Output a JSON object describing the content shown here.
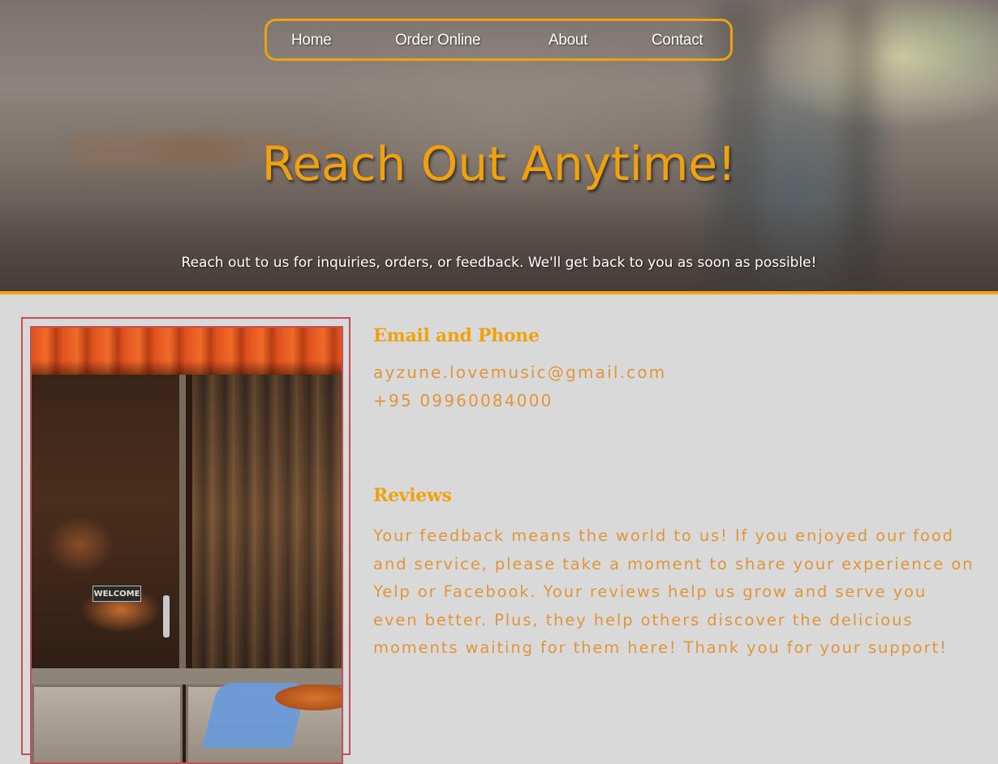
{
  "nav": {
    "items": [
      "Home",
      "Order Online",
      "About",
      "Contact"
    ],
    "border_color": "#f0a10f"
  },
  "hero": {
    "title": "Reach Out Anytime!",
    "subtitle": "Reach out to us for inquiries, orders, or feedback. We'll get back to you as soon as possible!"
  },
  "contact": {
    "heading": "Email and Phone",
    "email": "ayzune.lovemusic@gmail.com",
    "phone": "+95 09960084000"
  },
  "reviews": {
    "heading": "Reviews",
    "body": "Your feedback means the world to us! If you enjoyed our food and service, please take a moment to share your experience on Yelp or Facebook. Your reviews help us grow and serve you even better. Plus, they help others discover the delicious moments waiting for them here! Thank you for your support!"
  },
  "photo": {
    "sign_text": "WELCOME"
  },
  "colors": {
    "accent": "#f0a10f",
    "text_orange": "#e0953a",
    "background": "#d9d9d9",
    "frame": "#c0505a"
  }
}
